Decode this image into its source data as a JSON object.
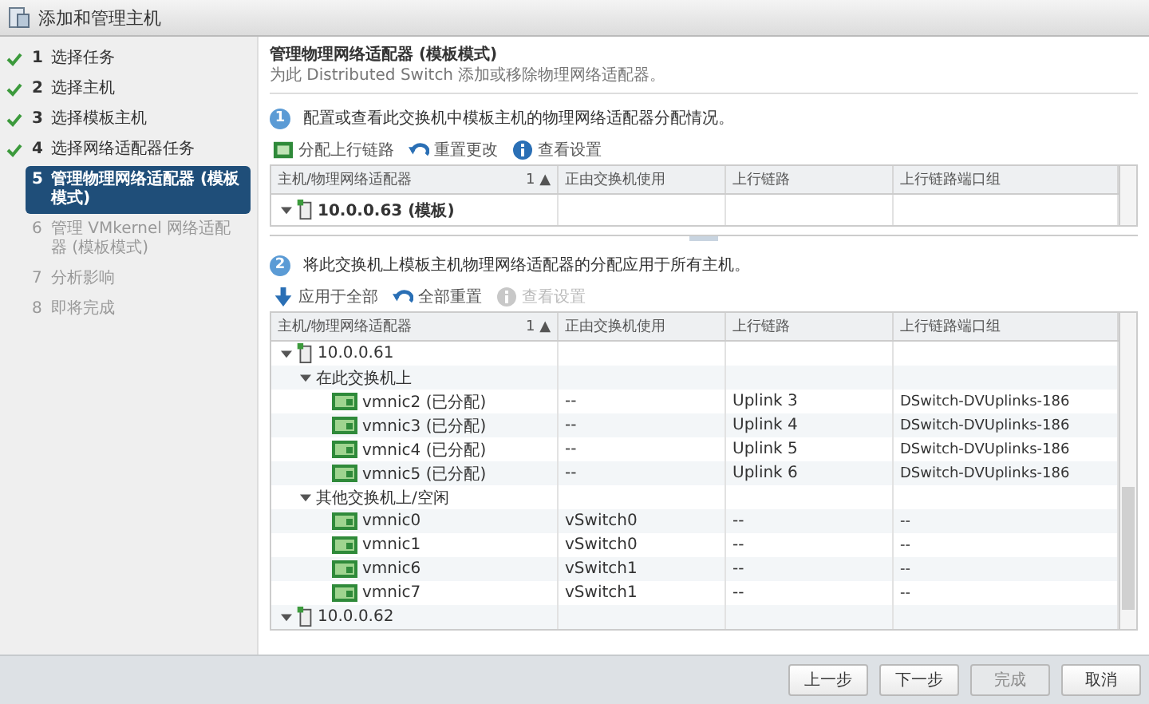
{
  "window": {
    "title": "添加和管理主机"
  },
  "steps": [
    {
      "number": "1",
      "label": "选择任务",
      "completed": true,
      "selected": false,
      "disabled": false
    },
    {
      "number": "2",
      "label": "选择主机",
      "completed": true,
      "selected": false,
      "disabled": false
    },
    {
      "number": "3",
      "label": "选择模板主机",
      "completed": true,
      "selected": false,
      "disabled": false
    },
    {
      "number": "4",
      "label": "选择网络适配器任务",
      "completed": true,
      "selected": false,
      "disabled": false
    },
    {
      "number": "5",
      "label": "管理物理网络适配器 (模板模式)",
      "completed": false,
      "selected": true,
      "disabled": false
    },
    {
      "number": "6",
      "label": "管理 VMkernel 网络适配器 (模板模式)",
      "completed": false,
      "selected": false,
      "disabled": true
    },
    {
      "number": "7",
      "label": "分析影响",
      "completed": false,
      "selected": false,
      "disabled": true
    },
    {
      "number": "8",
      "label": "即将完成",
      "completed": false,
      "selected": false,
      "disabled": true
    }
  ],
  "page": {
    "title": "管理物理网络适配器 (模板模式)",
    "subtitle": "为此 Distributed Switch 添加或移除物理网络适配器。"
  },
  "section_1": {
    "number": "1",
    "instruction": "配置或查看此交换机中模板主机的物理网络适配器分配情况。",
    "toolbar": [
      {
        "kind": "assign",
        "label": "分配上行链路",
        "disabled": false
      },
      {
        "kind": "reset",
        "label": "重置更改",
        "disabled": false
      },
      {
        "kind": "info",
        "label": "查看设置",
        "disabled": false
      }
    ],
    "table": {
      "columns": [
        {
          "label": "主机/物理网络适配器",
          "sort": "1 ▲"
        },
        {
          "label": "正由交换机使用"
        },
        {
          "label": "上行链路"
        },
        {
          "label": "上行链路端口组"
        }
      ],
      "rows": [
        {
          "kind": "host",
          "name": "10.0.0.63 (模板)",
          "bold": true,
          "expanded": true
        }
      ]
    }
  },
  "section_2": {
    "number": "2",
    "instruction": "将此交换机上模板主机物理网络适配器的分配应用于所有主机。",
    "toolbar": [
      {
        "kind": "apply",
        "label": "应用于全部",
        "disabled": false
      },
      {
        "kind": "reset",
        "label": "全部重置",
        "disabled": false
      },
      {
        "kind": "info",
        "label": "查看设置",
        "disabled": true
      }
    ],
    "table": {
      "columns": [
        {
          "label": "主机/物理网络适配器",
          "sort": "1 ▲"
        },
        {
          "label": "正由交换机使用"
        },
        {
          "label": "上行链路"
        },
        {
          "label": "上行链路端口组"
        }
      ],
      "rows": [
        {
          "kind": "host",
          "name": "10.0.0.61",
          "bold": false,
          "expanded": true,
          "children": [
            {
              "kind": "group",
              "name": "在此交换机上",
              "expanded": true,
              "children": [
                {
                  "kind": "nic",
                  "name": "vmnic2 (已分配)",
                  "cells": [
                    "--",
                    "Uplink 3",
                    "DSwitch-DVUplinks-186"
                  ]
                },
                {
                  "kind": "nic",
                  "name": "vmnic3 (已分配)",
                  "cells": [
                    "--",
                    "Uplink 4",
                    "DSwitch-DVUplinks-186"
                  ]
                },
                {
                  "kind": "nic",
                  "name": "vmnic4 (已分配)",
                  "cells": [
                    "--",
                    "Uplink 5",
                    "DSwitch-DVUplinks-186"
                  ]
                },
                {
                  "kind": "nic",
                  "name": "vmnic5 (已分配)",
                  "cells": [
                    "--",
                    "Uplink 6",
                    "DSwitch-DVUplinks-186"
                  ]
                }
              ]
            },
            {
              "kind": "group",
              "name": "其他交换机上/空闲",
              "expanded": true,
              "children": [
                {
                  "kind": "nic",
                  "name": "vmnic0",
                  "cells": [
                    "vSwitch0",
                    "--",
                    "--"
                  ]
                },
                {
                  "kind": "nic",
                  "name": "vmnic1",
                  "cells": [
                    "vSwitch0",
                    "--",
                    "--"
                  ]
                },
                {
                  "kind": "nic",
                  "name": "vmnic6",
                  "cells": [
                    "vSwitch1",
                    "--",
                    "--"
                  ]
                },
                {
                  "kind": "nic",
                  "name": "vmnic7",
                  "cells": [
                    "vSwitch1",
                    "--",
                    "--"
                  ]
                }
              ]
            }
          ]
        },
        {
          "kind": "host",
          "name": "10.0.0.62",
          "bold": false,
          "expanded": true
        }
      ]
    }
  },
  "buttons": [
    {
      "label": "上一步",
      "disabled": false
    },
    {
      "label": "下一步",
      "disabled": false
    },
    {
      "label": "完成",
      "disabled": true
    },
    {
      "label": "取消",
      "disabled": false
    }
  ]
}
